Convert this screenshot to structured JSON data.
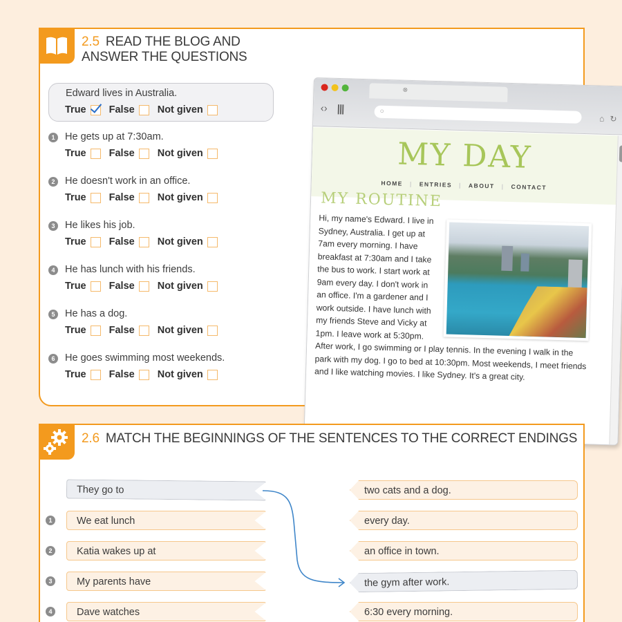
{
  "section_25": {
    "number": "2.5",
    "title": "READ THE BLOG AND ANSWER THE QUESTIONS",
    "icon": "open-book-icon",
    "example": {
      "statement": "Edward lives in Australia.",
      "selected": "True"
    },
    "choice_labels": [
      "True",
      "False",
      "Not given"
    ],
    "questions": [
      {
        "number": "1",
        "statement": "He gets up at 7:30am."
      },
      {
        "number": "2",
        "statement": "He doesn't work in an office."
      },
      {
        "number": "3",
        "statement": "He likes his job."
      },
      {
        "number": "4",
        "statement": "He has lunch with his friends."
      },
      {
        "number": "5",
        "statement": "He has a dog."
      },
      {
        "number": "6",
        "statement": "He goes swimming most weekends."
      }
    ]
  },
  "browser": {
    "nav_icons": [
      "back-forward-icon",
      "bookmarks-icon"
    ],
    "search_icon": "search-icon",
    "right_icons": [
      "home-icon",
      "reload-icon"
    ],
    "site_title": "MY DAY",
    "site_nav": [
      "HOME",
      "ENTRIES",
      "ABOUT",
      "CONTACT"
    ],
    "post_title": "MY ROUTINE",
    "post_text": "Hi, my name's Edward. I live in Sydney, Australia. I get up at 7am every morning. I have breakfast at 7:30am and I take the bus to work. I start work at 9am every day. I don't work in an office. I'm a gardener and I work outside. I have lunch with my friends Steve and Vicky at 1pm. I leave work at 5:30pm. After work, I go swimming or I play tennis. In the evening I walk in the park with my dog. I go to bed at 10:30pm. Most weekends, I meet friends and I like watching movies. I like Sydney. It's a great city.",
    "photo_alt": "Sydney harbour aerial photo"
  },
  "section_26": {
    "number": "2.6",
    "title": "MATCH THE BEGINNINGS OF THE SENTENCES TO THE CORRECT ENDINGS",
    "icon": "gears-icon",
    "beginnings": [
      {
        "number": "",
        "text": "They go to",
        "example": true
      },
      {
        "number": "1",
        "text": "We eat lunch"
      },
      {
        "number": "2",
        "text": "Katia wakes up at"
      },
      {
        "number": "3",
        "text": "My parents have"
      },
      {
        "number": "4",
        "text": "Dave watches"
      }
    ],
    "endings": [
      {
        "text": "two cats and a dog."
      },
      {
        "text": "every day."
      },
      {
        "text": "an office in town."
      },
      {
        "text": "the gym after work.",
        "example": true
      },
      {
        "text": "6:30 every morning."
      }
    ],
    "example_link": {
      "from": "They go to",
      "to": "the gym after work."
    }
  },
  "colors": {
    "accent": "#f39a1e",
    "page_bg": "#fdeede",
    "check": "#2b6fc9",
    "site_green": "#a7c65a"
  }
}
